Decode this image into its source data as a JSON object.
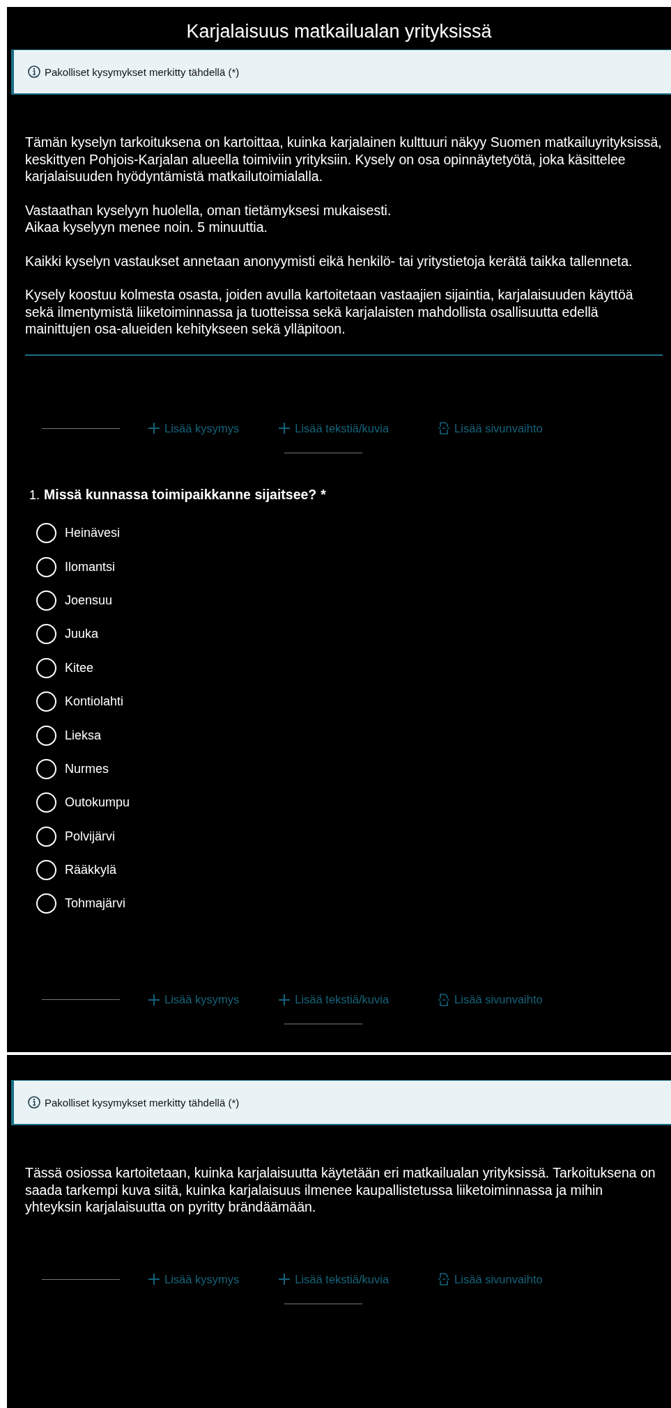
{
  "title": "Karjalaisuus matkailualan yrityksissä",
  "sections": [
    {
      "notice": "Pakolliset kysymykset merkitty tähdellä (*)",
      "paragraphs": [
        "Tämän kyselyn tarkoituksena on kartoittaa, kuinka karjalainen kulttuuri näkyy Suomen matkailuyrityksissä, keskittyen Pohjois-Karjalan alueella toimiviin yrityksiin. Kysely on osa opinnäytetyötä, joka käsittelee karjalaisuuden hyödyntämistä matkailutoimialalla.",
        "Vastaathan kyselyyn huolella, oman tietämyksesi mukaisesti.\nAikaa kyselyyn menee noin. 5 minuuttia.",
        "Kaikki kyselyn vastaukset annetaan anonyymisti eikä henkilö- tai yritystietoja kerätä taikka tallenneta.",
        "Kysely koostuu kolmesta osasta, joiden avulla kartoitetaan vastaajien sijaintia, karjalaisuuden käyttöä sekä ilmentymistä liiketoiminnassa ja tuotteissa sekä karjalaisten mahdollista osallisuutta edellä mainittujen osa-alueiden kehitykseen sekä ylläpitoon."
      ],
      "underlined": true,
      "toolbar": [
        {
          "kind": "plus",
          "label": "Lisää kysymys"
        },
        {
          "kind": "plus",
          "label": "Lisää tekstiä/kuvia"
        },
        {
          "kind": "page",
          "label": "Lisää sivunvaihto"
        }
      ],
      "question": {
        "number": "1.",
        "text": "Missä kunnassa toimipaikkanne sijaitsee?",
        "required": "*",
        "options": [
          {
            "label": "Heinävesi",
            "selected": false
          },
          {
            "label": "Ilomantsi",
            "selected": false
          },
          {
            "label": "Joensuu",
            "selected": false
          },
          {
            "label": "Juuka",
            "selected": false
          },
          {
            "label": "Kitee",
            "selected": false
          },
          {
            "label": "Kontiolahti",
            "selected": false
          },
          {
            "label": "Lieksa",
            "selected": false
          },
          {
            "label": "Nurmes",
            "selected": false
          },
          {
            "label": "Outokumpu",
            "selected": false
          },
          {
            "label": "Polvijärvi",
            "selected": false
          },
          {
            "label": "Rääkkylä",
            "selected": false
          },
          {
            "label": "Tohmajärvi",
            "selected": false
          }
        ]
      },
      "toolbar2": [
        {
          "kind": "plus",
          "label": "Lisää kysymys"
        },
        {
          "kind": "plus",
          "label": "Lisää tekstiä/kuvia"
        },
        {
          "kind": "page",
          "label": "Lisää sivunvaihto"
        }
      ]
    },
    {
      "notice": "Pakolliset kysymykset merkitty tähdellä (*)",
      "paragraphs": [
        "Tässä osiossa kartoitetaan, kuinka karjalaisuutta käytetään eri matkailualan yrityksissä. Tarkoituksena on saada tarkempi kuva siitä, kuinka karjalaisuus ilmenee kaupallistetussa liiketoiminnassa ja mihin yhteyksin karjalaisuutta on pyritty brändäämään."
      ],
      "toolbar": [
        {
          "kind": "plus",
          "label": "Lisää kysymys"
        },
        {
          "kind": "plus",
          "label": "Lisää tekstiä/kuvia"
        },
        {
          "kind": "page",
          "label": "Lisää sivunvaihto"
        }
      ]
    }
  ]
}
